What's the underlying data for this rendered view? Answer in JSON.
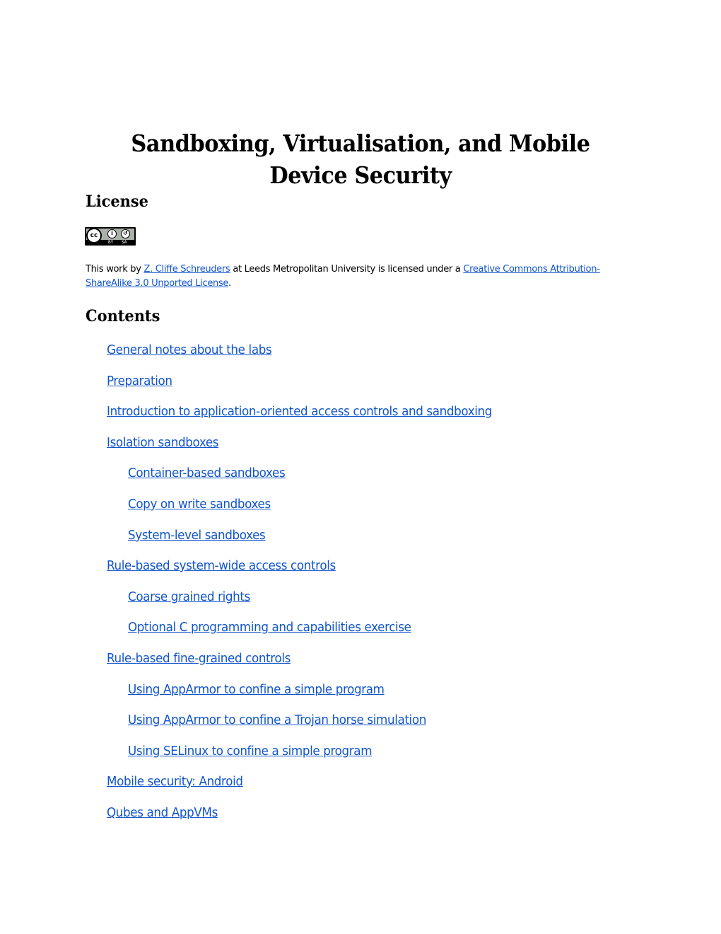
{
  "document": {
    "title": "Sandboxing, Virtualisation, and Mobile Device Security",
    "license_heading": "License",
    "license_badge": {
      "icon": "cc-by-sa-badge",
      "cc_text": "cc",
      "by_label": "BY",
      "sa_label": "SA",
      "by_glyph": "i",
      "sa_glyph": "↺"
    },
    "license_text": {
      "prefix": "This work by ",
      "author_link": "Z. Cliffe Schreuders",
      "middle": " at Leeds Metropolitan University is licensed under a ",
      "license_link": "Creative Commons Attribution-ShareAlike 3.0 Unported License",
      "suffix": "."
    },
    "contents_heading": "Contents",
    "toc": [
      {
        "label": "General notes about the labs",
        "level": 1
      },
      {
        "label": "Preparation",
        "level": 1
      },
      {
        "label": "Introduction to application-oriented access controls and sandboxing",
        "level": 1
      },
      {
        "label": "Isolation sandboxes",
        "level": 1
      },
      {
        "label": "Container-based sandboxes",
        "level": 2
      },
      {
        "label": "Copy on write sandboxes",
        "level": 2
      },
      {
        "label": "System-level sandboxes",
        "level": 2
      },
      {
        "label": "Rule-based system-wide access controls",
        "level": 1
      },
      {
        "label": "Coarse grained rights",
        "level": 2
      },
      {
        "label": "Optional C programming and capabilities exercise",
        "level": 2
      },
      {
        "label": "Rule-based fine-grained controls",
        "level": 1
      },
      {
        "label": "Using AppArmor to confine a simple program",
        "level": 2
      },
      {
        "label": "Using AppArmor to confine a Trojan horse simulation",
        "level": 2
      },
      {
        "label": "Using SELinux to confine a simple program",
        "level": 2
      },
      {
        "label": "Mobile security: Android",
        "level": 1
      },
      {
        "label": "Qubes and AppVMs",
        "level": 1
      }
    ]
  },
  "colors": {
    "link": "#1155cc",
    "text": "#000000",
    "background": "#ffffff"
  }
}
